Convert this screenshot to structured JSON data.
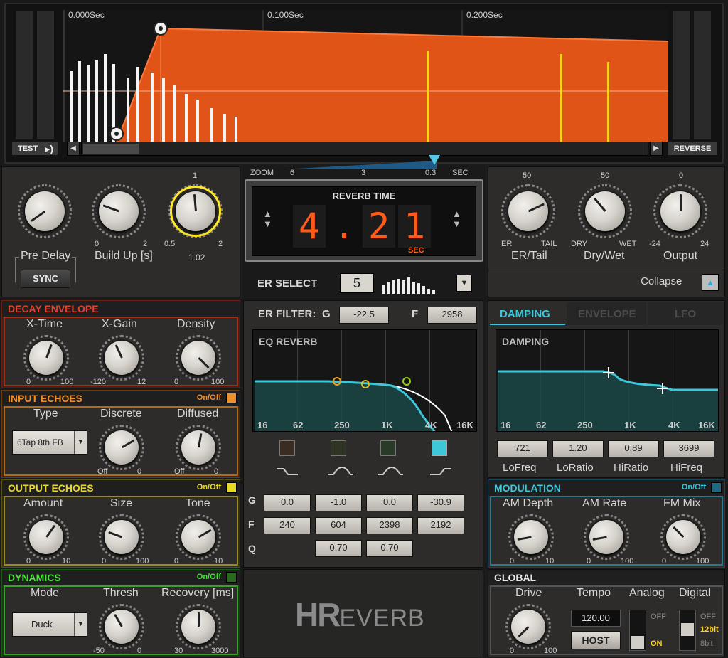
{
  "display": {
    "time_labels": [
      "0.000Sec",
      "0.100Sec",
      "0.200Sec"
    ],
    "test_label": "TEST",
    "reverse_label": "REVERSE",
    "zoom": {
      "label": "ZOOM",
      "ticks": [
        "6",
        "3",
        "0.3"
      ],
      "unit": "SEC"
    }
  },
  "reverb_time": {
    "title": "REVERB TIME",
    "digits": [
      "4",
      ".",
      "2",
      "1"
    ],
    "unit": "SEC"
  },
  "er_select": {
    "label": "ER SELECT",
    "value": "5"
  },
  "left_top": {
    "pre_delay_label": "Pre Delay",
    "build_up_label": "Build Up [s]",
    "build_up_min": "0",
    "build_up_max": "2",
    "third_top": "1",
    "third_min": "0.5",
    "third_max": "2",
    "third_value": "1.02",
    "sync_label": "SYNC"
  },
  "right_top": {
    "er_tail": {
      "label": "ER/Tail",
      "top": "50",
      "min": "ER",
      "max": "TAIL"
    },
    "dry_wet": {
      "label": "Dry/Wet",
      "top": "50",
      "min": "DRY",
      "max": "WET"
    },
    "output": {
      "label": "Output",
      "top": "0",
      "min": "-24",
      "max": "24"
    },
    "collapse_label": "Collapse"
  },
  "decay_envelope": {
    "title": "DECAY ENVELOPE",
    "knobs": [
      {
        "label": "X-Time",
        "min": "0",
        "max": "100"
      },
      {
        "label": "X-Gain",
        "min": "-120",
        "max": "12"
      },
      {
        "label": "Density",
        "min": "0",
        "max": "100"
      }
    ]
  },
  "input_echoes": {
    "title": "INPUT ECHOES",
    "onoff": "On/Off",
    "type_label": "Type",
    "type_value": "6Tap 8th FB",
    "knobs": [
      {
        "label": "Discrete",
        "min": "Off",
        "max": "0"
      },
      {
        "label": "Diffused",
        "min": "Off",
        "max": "0"
      }
    ]
  },
  "output_echoes": {
    "title": "OUTPUT ECHOES",
    "onoff": "On/Off",
    "knobs": [
      {
        "label": "Amount",
        "min": "0",
        "max": "10"
      },
      {
        "label": "Size",
        "min": "0",
        "max": "100"
      },
      {
        "label": "Tone",
        "min": "0",
        "max": "10"
      }
    ]
  },
  "dynamics": {
    "title": "DYNAMICS",
    "onoff": "On/Off",
    "mode_label": "Mode",
    "mode_value": "Duck",
    "knobs": [
      {
        "label": "Thresh",
        "min": "-50",
        "max": "0"
      },
      {
        "label": "Recovery [ms]",
        "min": "30",
        "max": "3000"
      }
    ]
  },
  "er_filter": {
    "label": "ER FILTER:",
    "g_label": "G",
    "g_value": "-22.5",
    "f_label": "F",
    "f_value": "2958"
  },
  "eq": {
    "title": "EQ REVERB",
    "freqs": [
      "16",
      "62",
      "250",
      "1K",
      "4K",
      "16K"
    ],
    "row_labels": [
      "G",
      "F",
      "Q"
    ],
    "g": [
      "0.0",
      "-1.0",
      "0.0",
      "-30.9"
    ],
    "f": [
      "240",
      "604",
      "2398",
      "2192"
    ],
    "q": [
      "0.70",
      "0.70"
    ]
  },
  "tabs": [
    "DAMPING",
    "ENVELOPE",
    "LFO"
  ],
  "damping": {
    "title": "DAMPING",
    "freqs": [
      "16",
      "62",
      "250",
      "1K",
      "4K",
      "16K"
    ],
    "values": [
      "721",
      "1.20",
      "0.89",
      "3699"
    ],
    "labels": [
      "LoFreq",
      "LoRatio",
      "HiRatio",
      "HiFreq"
    ]
  },
  "modulation": {
    "title": "MODULATION",
    "onoff": "On/Off",
    "knobs": [
      {
        "label": "AM Depth",
        "min": "0",
        "max": "10"
      },
      {
        "label": "AM Rate",
        "min": "0",
        "max": "100"
      },
      {
        "label": "FM Mix",
        "min": "0",
        "max": "100"
      }
    ]
  },
  "global": {
    "title": "GLOBAL",
    "drive_label": "Drive",
    "drive_min": "0",
    "drive_max": "100",
    "tempo_label": "Tempo",
    "tempo_value": "120.00",
    "host_label": "HOST",
    "analog_label": "Analog",
    "analog_off": "OFF",
    "analog_on": "ON",
    "digital_label": "Digital",
    "digital_off": "OFF",
    "digital_12": "12bit",
    "digital_8": "8bit"
  },
  "logo": {
    "hr": "HR",
    "everb": "EVERB"
  },
  "colors": {
    "accent_orange": "#e05418",
    "accent_cyan": "#3ec7d8",
    "red_hdr": "#e8402a",
    "orange_hdr": "#f0902a",
    "yellow_hdr": "#e8d82a",
    "green_hdr": "#4ae23a",
    "digit_red": "#ff5a1a"
  }
}
